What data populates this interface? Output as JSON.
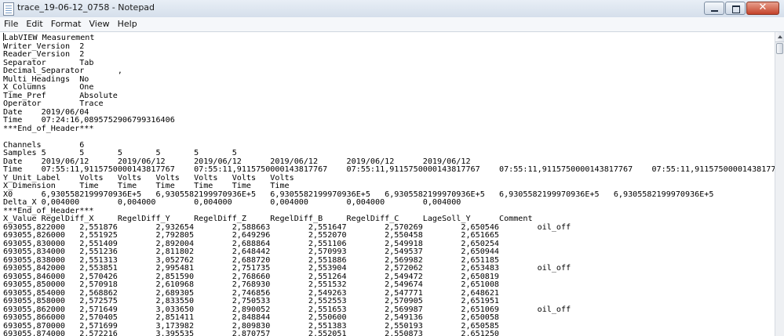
{
  "window": {
    "title": "trace_19-06-12_0758 - Notepad",
    "close_glyph": "✕",
    "icons": [
      "notepad-icon",
      "minimize-icon",
      "maximize-icon",
      "close-icon"
    ]
  },
  "menu": {
    "file": "File",
    "edit": "Edit",
    "format": "Format",
    "view": "View",
    "help": "Help"
  },
  "document": {
    "first_char": "L",
    "content": "abVIEW Measurement\nWriter_Version  2\nReader_Version  2\nSeparator       Tab\nDecimal_Separator       ,\nMulti_Headings  No\nX_Columns       One\nTime_Pref       Absolute\nOperator        Trace\nDate    2019/06/04\nTime    07:24:16,0895752906799316406\n***End_of_Header***\n\nChannels        6\nSamples 5       5       5       5       5       5\nDate    2019/06/12      2019/06/12      2019/06/12      2019/06/12      2019/06/12      2019/06/12\nTime    07:55:11,9115750000143817767    07:55:11,9115750000143817767    07:55:11,9115750000143817767    07:55:11,9115750000143817767    07:55:11,9115750000143817767    07:55:11,91157500\nY_Unit_Label    Volts   Volts   Volts   Volts   Volts   Volts\nX_Dimension     Time    Time    Time    Time    Time    Time\nX0      6,9305582199970936E+5   6,9305582199970936E+5   6,9305582199970936E+5   6,9305582199970936E+5   6,9305582199970936E+5   6,9305582199970936E+5\nDelta_X 0,004000        0,004000        0,004000        0,004000        0,004000        0,004000\n***End_of_Header***\nX_Value RegelDiff_X     RegelDiff_Y     RegelDiff_Z     RegelDiff_B     RegelDiff_C     LageSoll_Y      Comment\n693055,822000   2,551876        2,932654        2,588663        2,551647        2,570269        2,650546        oil_off\n693055,826000   2,551925        2,792805        2,649296        2,552070        2,550458        2,651665\n693055,830000   2,551409        2,892004        2,688864        2,551106        2,549918        2,650254\n693055,834000   2,551236        2,811802        2,648442        2,570993        2,549537        2,650944\n693055,838000   2,551313        3,052762        2,688720        2,551886        2,569982        2,651185\n693055,842000   2,553851        2,995481        2,751735        2,553904        2,572062        2,653483        oil_off\n693055,846000   2,570426        2,851590        2,768660        2,551264        2,549472        2,650819\n693055,850000   2,570918        2,610968        2,768930        2,551532        2,549674        2,651008\n693055,854000   2,568862        2,689305        2,746856        2,549263        2,547771        2,648621\n693055,858000   2,572575        2,833550        2,750533        2,552553        2,570905        2,651951\n693055,862000   2,571649        3,033650        2,890052        2,551653        2,569987        2,651069        oil_off\n693055,866000   2,570405        2,851411        2,848844        2,550600        2,549136        2,650058\n693055,870000   2,571699        3,173982        2,809830        2,551383        2,550193        2,650585\n693055,874000   2,572216        3,395535        2,870757        2,552051        2,550873        2,651250"
  }
}
